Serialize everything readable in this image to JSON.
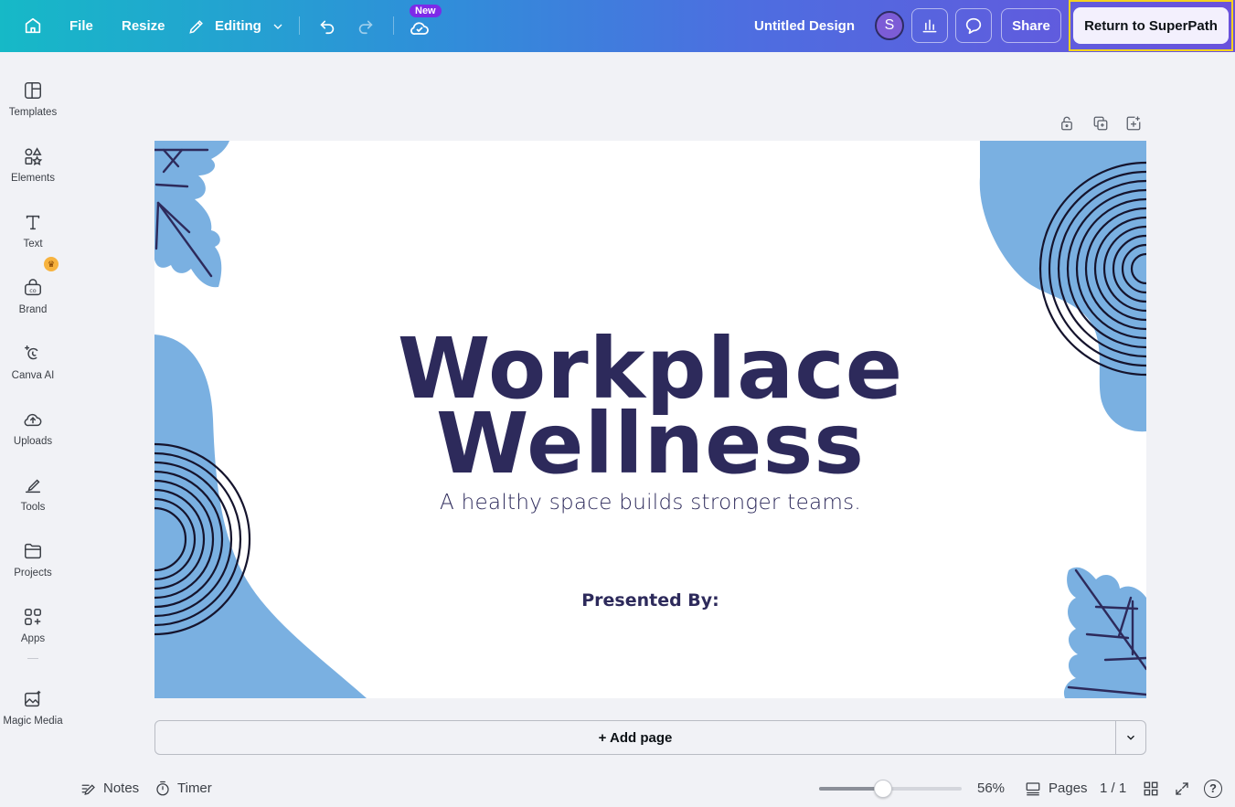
{
  "topbar": {
    "home_icon": "home-icon",
    "file_label": "File",
    "resize_label": "Resize",
    "editing_label": "Editing",
    "new_badge": "New",
    "design_title": "Untitled Design",
    "avatar_initial": "S",
    "share_label": "Share",
    "return_label": "Return to SuperPath"
  },
  "sidebar": {
    "items": [
      {
        "label": "Templates",
        "icon": "templates-icon"
      },
      {
        "label": "Elements",
        "icon": "elements-icon"
      },
      {
        "label": "Text",
        "icon": "text-icon"
      },
      {
        "label": "Brand",
        "icon": "brand-icon"
      },
      {
        "label": "Canva AI",
        "icon": "canva-ai-icon"
      },
      {
        "label": "Uploads",
        "icon": "uploads-icon"
      },
      {
        "label": "Tools",
        "icon": "tools-icon"
      },
      {
        "label": "Projects",
        "icon": "projects-icon"
      },
      {
        "label": "Apps",
        "icon": "apps-icon"
      },
      {
        "label": "Magic Media",
        "icon": "magic-media-icon"
      }
    ],
    "crown_glyph": "♛"
  },
  "slide": {
    "title_line1": "Workplace",
    "title_line2": "Wellness",
    "subtitle": "A healthy space builds stronger teams.",
    "presented_by": "Presented By:"
  },
  "addpage": {
    "label": "+ Add page"
  },
  "bottombar": {
    "notes_label": "Notes",
    "timer_label": "Timer",
    "zoom_label": "56%",
    "zoom_fraction": 0.45,
    "pages_label": "Pages",
    "page_count": "1 / 1",
    "help_glyph": "?"
  },
  "colors": {
    "accent_blue": "#7ab0e1",
    "navy": "#2d2a5b",
    "highlight": "#f4d21f"
  }
}
